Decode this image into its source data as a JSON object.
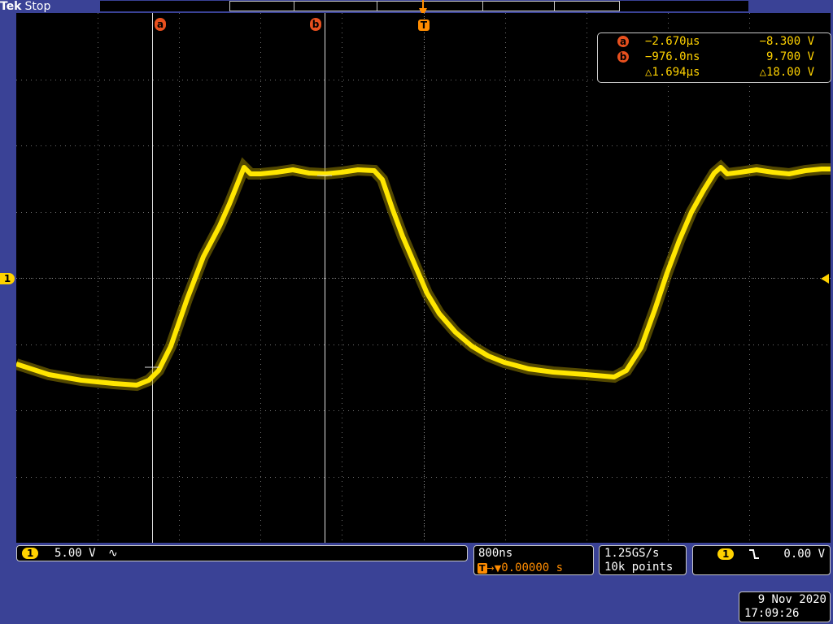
{
  "brand": "Tek",
  "status": "Stop",
  "cursors": {
    "a_label": "a",
    "b_label": "b",
    "trigger_label": "T",
    "a_time": "−2.670μs",
    "a_volt": "−8.300 V",
    "b_time": "−976.0ns",
    "b_volt": "9.700 V",
    "delta_time": "△1.694μs",
    "delta_volt": "△18.00 V"
  },
  "channel": {
    "number": "1",
    "scale": "5.00 V",
    "coupling_icon": "∿",
    "ground_marker": "1"
  },
  "horizontal": {
    "scale": "800ns",
    "trigger_position_icon": "T→▼",
    "trigger_position": "0.00000 s"
  },
  "acquisition": {
    "sample_rate": "1.25GS/s",
    "record_length": "10k points"
  },
  "trigger": {
    "source": "1",
    "slope_icon": "falling-edge-icon",
    "slope_glyph": "Ⲧ",
    "level": "0.00 V"
  },
  "datetime": {
    "date": "9 Nov 2020",
    "time": "17:09:26"
  },
  "colors": {
    "background": "#3a4296",
    "trace": "#ffd200",
    "cursor": "#e8501e"
  }
}
